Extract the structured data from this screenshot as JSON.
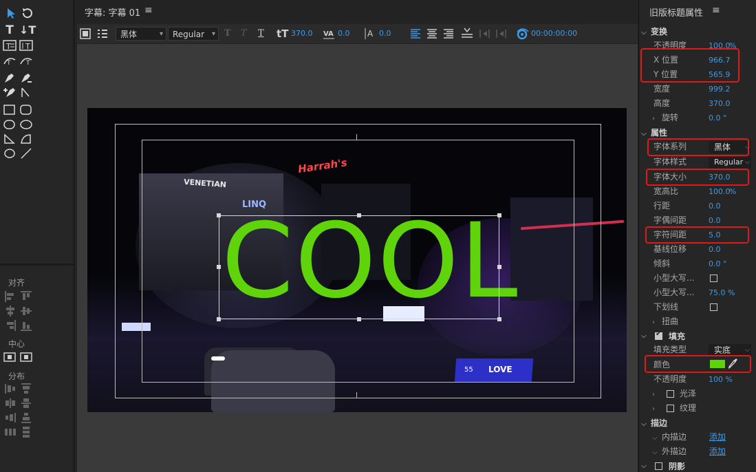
{
  "center_panel": {
    "tab_label": "字幕: 字幕 01",
    "menu_glyph": "≡"
  },
  "toolbar": {
    "font_family": "黑体",
    "font_style": "Regular",
    "font_size": "370.0",
    "kerning": "0.0",
    "leading": "0.0",
    "timecode": "00:00:00:00"
  },
  "video": {
    "title_text": "COOL",
    "title_color": "#5fd40a",
    "sign_harrahs": "Harrah's",
    "sign_venetian": "VENETIAN",
    "sign_linq": "LINQ",
    "sign_love": "LOVE",
    "sign_55": "55"
  },
  "left_panel": {
    "align_label": "对齐",
    "center_label": "中心",
    "distribute_label": "分布"
  },
  "props": {
    "title": "旧版标题属性",
    "menu_glyph": "≡",
    "transform": {
      "label": "变换",
      "opacity_label": "不透明度",
      "opacity_value": "100.0",
      "opacity_unit": "%",
      "x_label": "X 位置",
      "x_value": "966.7",
      "y_label": "Y 位置",
      "y_value": "565.9",
      "width_label": "宽度",
      "width_value": "999.2",
      "height_label": "高度",
      "height_value": "370.0",
      "rotation_label": "旋转",
      "rotation_value": "0.0 °"
    },
    "attributes": {
      "label": "属性",
      "family_label": "字体系列",
      "family_value": "黑体",
      "style_label": "字体样式",
      "style_value": "Regular",
      "size_label": "字体大小",
      "size_value": "370.0",
      "aspect_label": "宽高比",
      "aspect_value": "100.0",
      "aspect_unit": "%",
      "leading_label": "行距",
      "leading_value": "0.0",
      "kerning_label": "字偶间距",
      "kerning_value": "0.0",
      "tracking_label": "字符间距",
      "tracking_value": "5.0",
      "baseline_label": "基线位移",
      "baseline_value": "0.0",
      "slant_label": "倾斜",
      "slant_value": "0.0 °",
      "smallcaps_label": "小型大写...",
      "smallcaps_size_label": "小型大写...",
      "smallcaps_size_value": "75.0 %",
      "underline_label": "下划线",
      "distort_label": "扭曲"
    },
    "fill": {
      "label": "填充",
      "type_label": "填充类型",
      "type_value": "实底",
      "color_label": "颜色",
      "color_value": "#5fd40a",
      "opacity_label": "不透明度",
      "opacity_value": "100 %",
      "sheen_label": "光泽",
      "texture_label": "纹理"
    },
    "stroke": {
      "label": "描边",
      "inner_label": "内描边",
      "inner_action": "添加",
      "outer_label": "外描边",
      "outer_action": "添加"
    },
    "shadow": {
      "label": "阴影"
    }
  }
}
